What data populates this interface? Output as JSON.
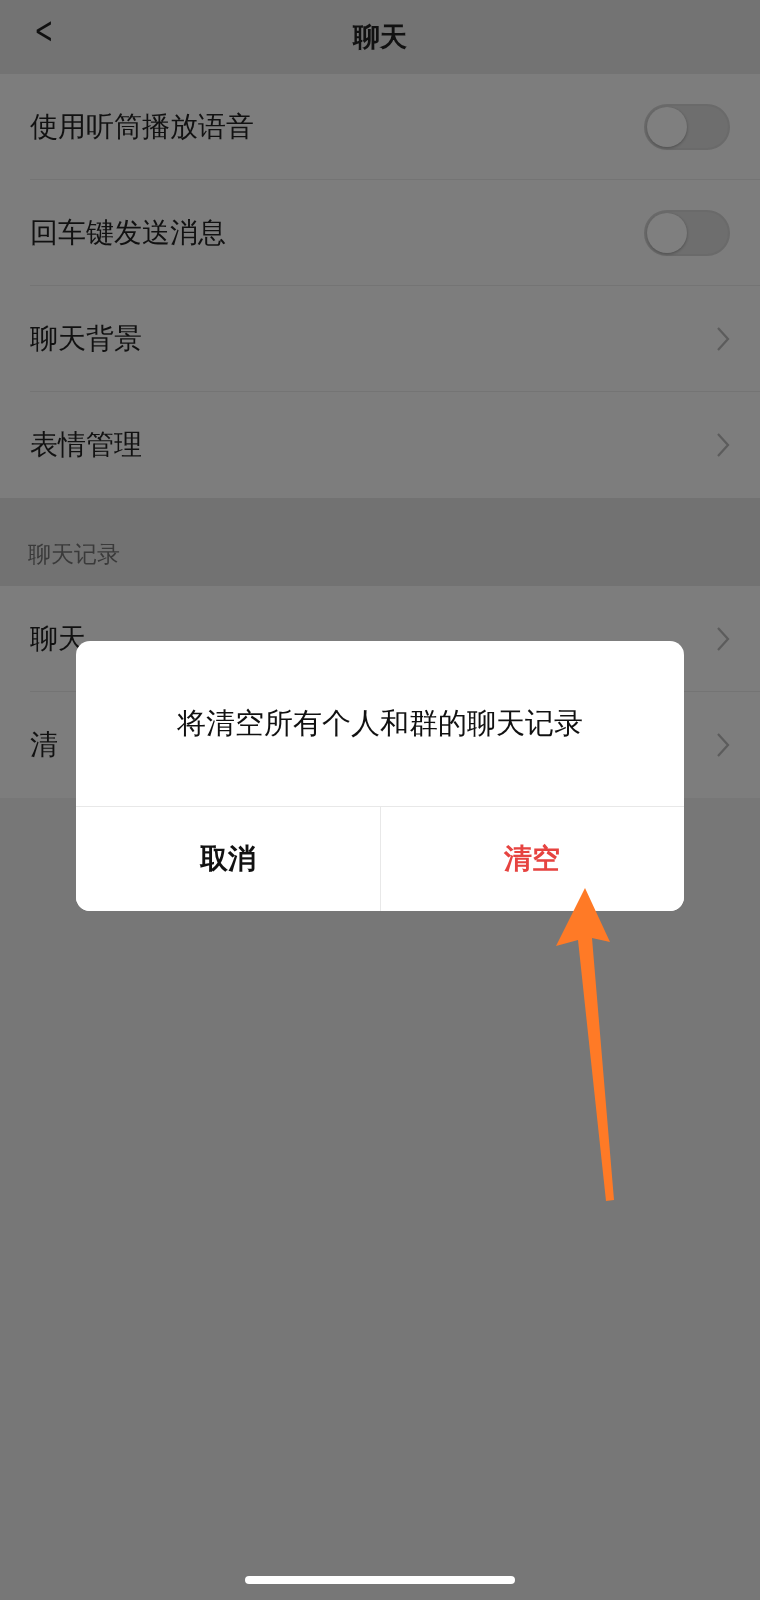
{
  "nav": {
    "back": "<",
    "title": "聊天"
  },
  "groups": [
    {
      "rows": [
        {
          "label": "使用听筒播放语音",
          "kind": "toggle",
          "on": false
        },
        {
          "label": "回车键发送消息",
          "kind": "toggle",
          "on": false
        },
        {
          "label": "聊天背景",
          "kind": "link"
        },
        {
          "label": "表情管理",
          "kind": "link"
        }
      ]
    },
    {
      "header": "聊天记录",
      "rows": [
        {
          "label": "聊天",
          "kind": "link"
        },
        {
          "label": "清",
          "kind": "link"
        }
      ]
    }
  ],
  "dialog": {
    "message": "将清空所有个人和群的聊天记录",
    "buttons": [
      {
        "label": "取消",
        "kind": "cancel"
      },
      {
        "label": "清空",
        "kind": "danger"
      }
    ]
  }
}
